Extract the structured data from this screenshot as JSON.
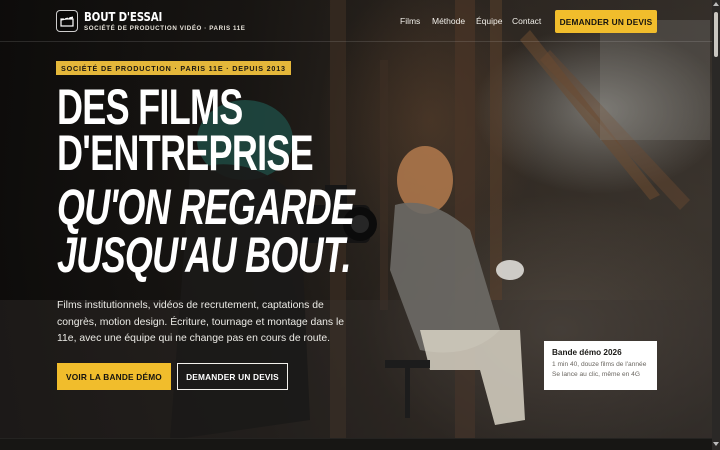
{
  "brand": {
    "name": "BOUT D'ESSAI",
    "tagline": "SOCIÉTÉ DE PRODUCTION VIDÉO · PARIS 11E",
    "logo_icon": "clapperboard-icon"
  },
  "nav": {
    "items": [
      {
        "label": "Films"
      },
      {
        "label": "Méthode"
      },
      {
        "label": "Équipe"
      },
      {
        "label": "Contact"
      }
    ],
    "cta_label": "DEMANDER UN DEVIS"
  },
  "hero": {
    "eyebrow": "SOCIÉTÉ DE PRODUCTION · PARIS 11E · DEPUIS 2013",
    "headline_line1": "DES FILMS",
    "headline_line2": "D'ENTREPRISE",
    "headline_line3": "QU'ON REGARDE",
    "headline_line4": "JUSQU'AU BOUT.",
    "lede": "Films institutionnels, vidéos de recrutement, captations de congrès, motion design. Écriture, tournage et montage dans le 11e, avec une équipe qui ne change pas en cours de route.",
    "primary_button": "VOIR LA BANDE DÉMO",
    "secondary_button": "DEMANDER UN DEVIS"
  },
  "demo_card": {
    "title": "Bande démo 2026",
    "line1": "1 min 40, douze films de l'année",
    "line2": "Se lance au clic, même en 4G"
  },
  "colors": {
    "accent": "#f1bd2c",
    "background": "#1a1917",
    "text": "#ffffff"
  }
}
